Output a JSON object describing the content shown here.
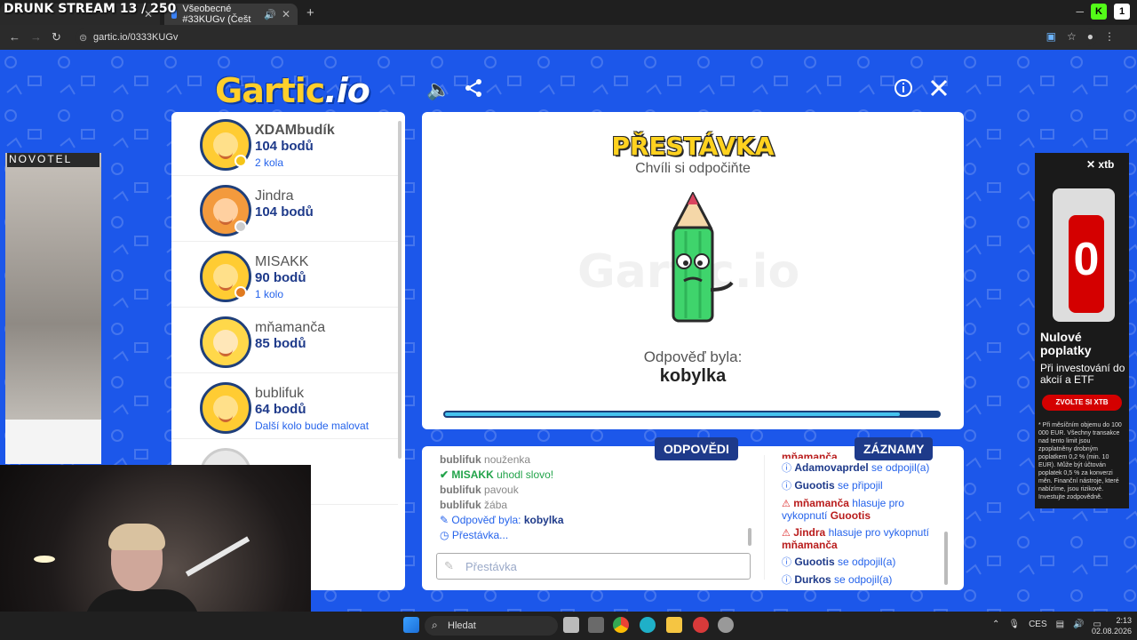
{
  "overlay": {
    "stream_title": "DRUNK STREAM 13 / 250"
  },
  "browser": {
    "tabs": [
      {
        "label": ""
      },
      {
        "label": "Všeobecné #33KUGv (Češt"
      }
    ],
    "url": "gartic.io/0333KUGv"
  },
  "game": {
    "logo_main": "Gartic",
    "logo_io": ".io",
    "players": [
      {
        "name": "XDAMbudík",
        "points": "104 bodů",
        "extra": "2 kola",
        "status_color": "#f5c518",
        "name_bold": true
      },
      {
        "name": "Jindra",
        "points": "104 bodů",
        "extra": "",
        "status_color": "#cccccc",
        "name_bold": false
      },
      {
        "name": "MISAKK",
        "points": "90 bodů",
        "extra": "1 kolo",
        "status_color": "#e07a1f",
        "name_bold": false
      },
      {
        "name": "mňamanča",
        "points": "85 bodů",
        "extra": "",
        "status_color": "",
        "name_bold": false
      },
      {
        "name": "bublifuk",
        "points": "64 bodů",
        "extra": "Další kolo bude malovat",
        "status_color": "",
        "name_bold": false
      }
    ],
    "center": {
      "title": "PŘESTÁVKA",
      "subtitle": "Chvíli si odpočiňte",
      "watermark": "Gartic.io",
      "answer_label": "Odpověď byla:",
      "answer": "kobylka",
      "progress": 0.92
    },
    "tab_answers": "ODPOVĚDI",
    "tab_records": "ZÁZNAMY",
    "answers": [
      {
        "who": "bublifuk",
        "text": "nouženka"
      },
      {
        "who": "MISAKK",
        "text": "uhodl slovo!",
        "correct": true
      },
      {
        "who": "bublifuk",
        "text": "pavouk"
      },
      {
        "who": "bublifuk",
        "text": "žába"
      }
    ],
    "answer_reveal_label": "Odpověď byla:",
    "answer_reveal_word": "kobylka",
    "pause_line": "Přestávka...",
    "input_placeholder": "Přestávka",
    "log": [
      {
        "type": "info",
        "name": "mňamanča",
        "text": ""
      },
      {
        "type": "info",
        "name": "Adamovaprdel",
        "text": "se odpojil(a)"
      },
      {
        "type": "info",
        "name": "Guootis",
        "text": "se připojil"
      },
      {
        "type": "warn",
        "name": "mňamanča",
        "text": "hlasuje pro vykopnutí",
        "target": "Guootis"
      },
      {
        "type": "warn",
        "name": "Jindra",
        "text": "hlasuje pro vykopnutí",
        "target": "mňamanča"
      },
      {
        "type": "info",
        "name": "Guootis",
        "text": "se odpojil(a)"
      },
      {
        "type": "info",
        "name": "Durkos",
        "text": "se odpojil(a)"
      }
    ]
  },
  "ads": {
    "left_brand": "NOVOTEL",
    "right_brand": "xtb",
    "right_headline": "Nulové poplatky",
    "right_sub": "Při investování do akcií a ETF",
    "right_cta": "ZVOLTE SI XTB",
    "right_zero": "0",
    "right_fine": "* Při měsíčním objemu do 100 000 EUR. Všechny transakce nad tento limit jsou zpoplatněny drobným poplatkem 0,2 % (min. 10 EUR). Může být účtován poplatek 0,5 % za konverzi měn. Finanční nástroje, které nabízíme, jsou rizikové. Investujte zodpovědně."
  },
  "taskbar": {
    "search": "Hledat",
    "lang": "CES",
    "time": "2:13",
    "date": "02.08.2026"
  }
}
